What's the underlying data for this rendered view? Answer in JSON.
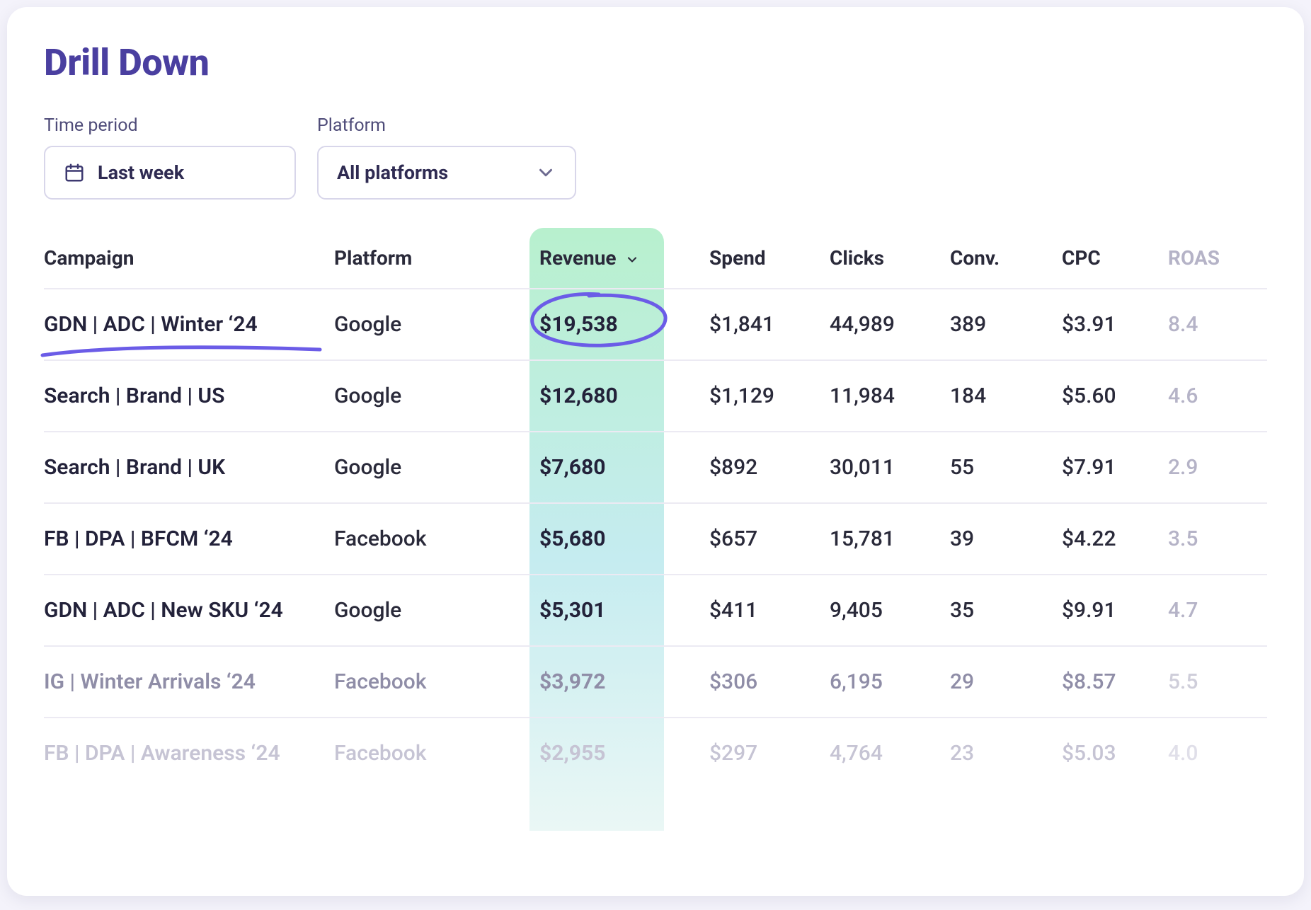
{
  "title": "Drill Down",
  "filters": {
    "time_label": "Time period",
    "time_value": "Last week",
    "platform_label": "Platform",
    "platform_value": "All platforms"
  },
  "columns": {
    "campaign": "Campaign",
    "platform": "Platform",
    "revenue": "Revenue",
    "spend": "Spend",
    "clicks": "Clicks",
    "conv": "Conv.",
    "cpc": "CPC",
    "roas": "ROAS"
  },
  "sort_column": "revenue",
  "rows": [
    {
      "campaign": "GDN | ADC | Winter ‘24",
      "platform": "Google",
      "revenue": "$19,538",
      "spend": "$1,841",
      "clicks": "44,989",
      "conv": "389",
      "cpc": "$3.91",
      "roas": "8.4"
    },
    {
      "campaign": "Search | Brand | US",
      "platform": "Google",
      "revenue": "$12,680",
      "spend": "$1,129",
      "clicks": "11,984",
      "conv": "184",
      "cpc": "$5.60",
      "roas": "4.6"
    },
    {
      "campaign": "Search | Brand | UK",
      "platform": "Google",
      "revenue": "$7,680",
      "spend": "$892",
      "clicks": "30,011",
      "conv": "55",
      "cpc": "$7.91",
      "roas": "2.9"
    },
    {
      "campaign": "FB | DPA | BFCM ‘24",
      "platform": "Facebook",
      "revenue": "$5,680",
      "spend": "$657",
      "clicks": "15,781",
      "conv": "39",
      "cpc": "$4.22",
      "roas": "3.5"
    },
    {
      "campaign": "GDN | ADC | New SKU ‘24",
      "platform": "Google",
      "revenue": "$5,301",
      "spend": "$411",
      "clicks": "9,405",
      "conv": "35",
      "cpc": "$9.91",
      "roas": "4.7"
    },
    {
      "campaign": "IG | Winter Arrivals ‘24",
      "platform": "Facebook",
      "revenue": "$3,972",
      "spend": "$306",
      "clicks": "6,195",
      "conv": "29",
      "cpc": "$8.57",
      "roas": "5.5"
    },
    {
      "campaign": "FB | DPA | Awareness ‘24",
      "platform": "Facebook",
      "revenue": "$2,955",
      "spend": "$297",
      "clicks": "4,764",
      "conv": "23",
      "cpc": "$5.03",
      "roas": "4.0"
    }
  ],
  "annotations": {
    "circled_cell": "rows.0.revenue",
    "underlined_cell": "rows.0.campaign",
    "color": "#6b5ce7"
  }
}
